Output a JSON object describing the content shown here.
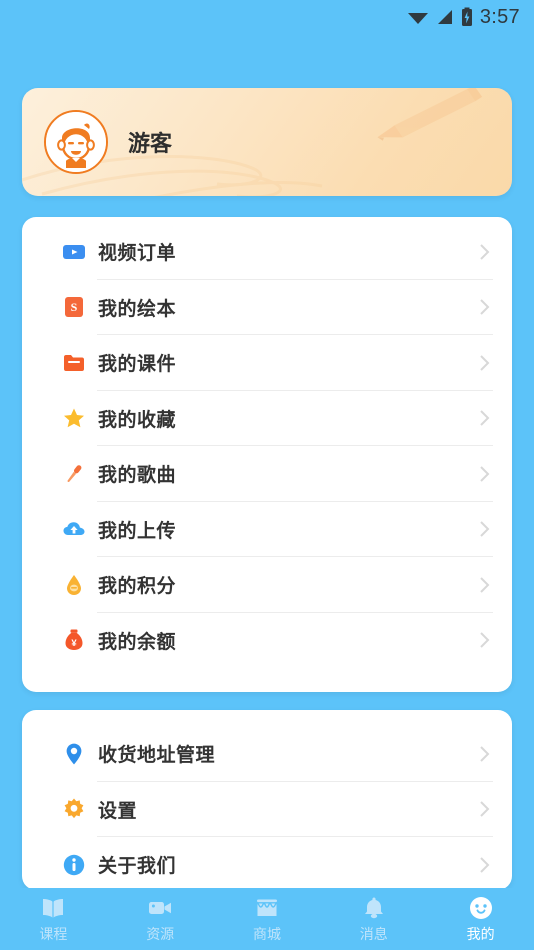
{
  "status_bar": {
    "time": "3:57",
    "icons": [
      "wifi-icon",
      "signal-icon",
      "battery-charging-icon"
    ]
  },
  "profile": {
    "name": "游客",
    "avatar_icon": "user-avatar-boy-icon",
    "watermarks": [
      "pencil-watermark",
      "swirl-watermark"
    ],
    "bg_start": "#FDF0DC",
    "bg_end": "#FAD9A9"
  },
  "theme": {
    "page_background": "#5CC3F9",
    "card_background": "#FFFFFF",
    "text_primary": "#333333",
    "nav_inactive": "#BFE4FB",
    "nav_active": "#FFFFFF",
    "divider": "#ECECEC"
  },
  "menu_primary": [
    {
      "label": "视频订单",
      "icon": "video-play-icon",
      "color": "#3B8EF0"
    },
    {
      "label": "我的绘本",
      "icon": "picture-book-s-icon",
      "color": "#F4683A"
    },
    {
      "label": "我的课件",
      "icon": "folder-icon",
      "color": "#F4602A"
    },
    {
      "label": "我的收藏",
      "icon": "star-icon",
      "color": "#FBBC2E"
    },
    {
      "label": "我的歌曲",
      "icon": "microphone-icon",
      "color": "#F4703A"
    },
    {
      "label": "我的上传",
      "icon": "cloud-upload-icon",
      "color": "#3FA9F5"
    },
    {
      "label": "我的积分",
      "icon": "points-drop-icon",
      "color": "#F9B233"
    },
    {
      "label": "我的余额",
      "icon": "money-bag-icon",
      "color": "#F4572A"
    }
  ],
  "menu_secondary": [
    {
      "label": "收货地址管理",
      "icon": "location-pin-icon",
      "color": "#2F8FEA"
    },
    {
      "label": "设置",
      "icon": "gear-icon",
      "color": "#F9A82E"
    },
    {
      "label": "关于我们",
      "icon": "info-icon",
      "color": "#3FA9F5"
    }
  ],
  "bottom_nav": [
    {
      "label": "课程",
      "icon": "book-icon",
      "active": false
    },
    {
      "label": "资源",
      "icon": "video-camera-icon",
      "active": false
    },
    {
      "label": "商城",
      "icon": "shop-icon",
      "active": false
    },
    {
      "label": "消息",
      "icon": "bell-icon",
      "active": false
    },
    {
      "label": "我的",
      "icon": "smiley-face-icon",
      "active": true
    }
  ]
}
